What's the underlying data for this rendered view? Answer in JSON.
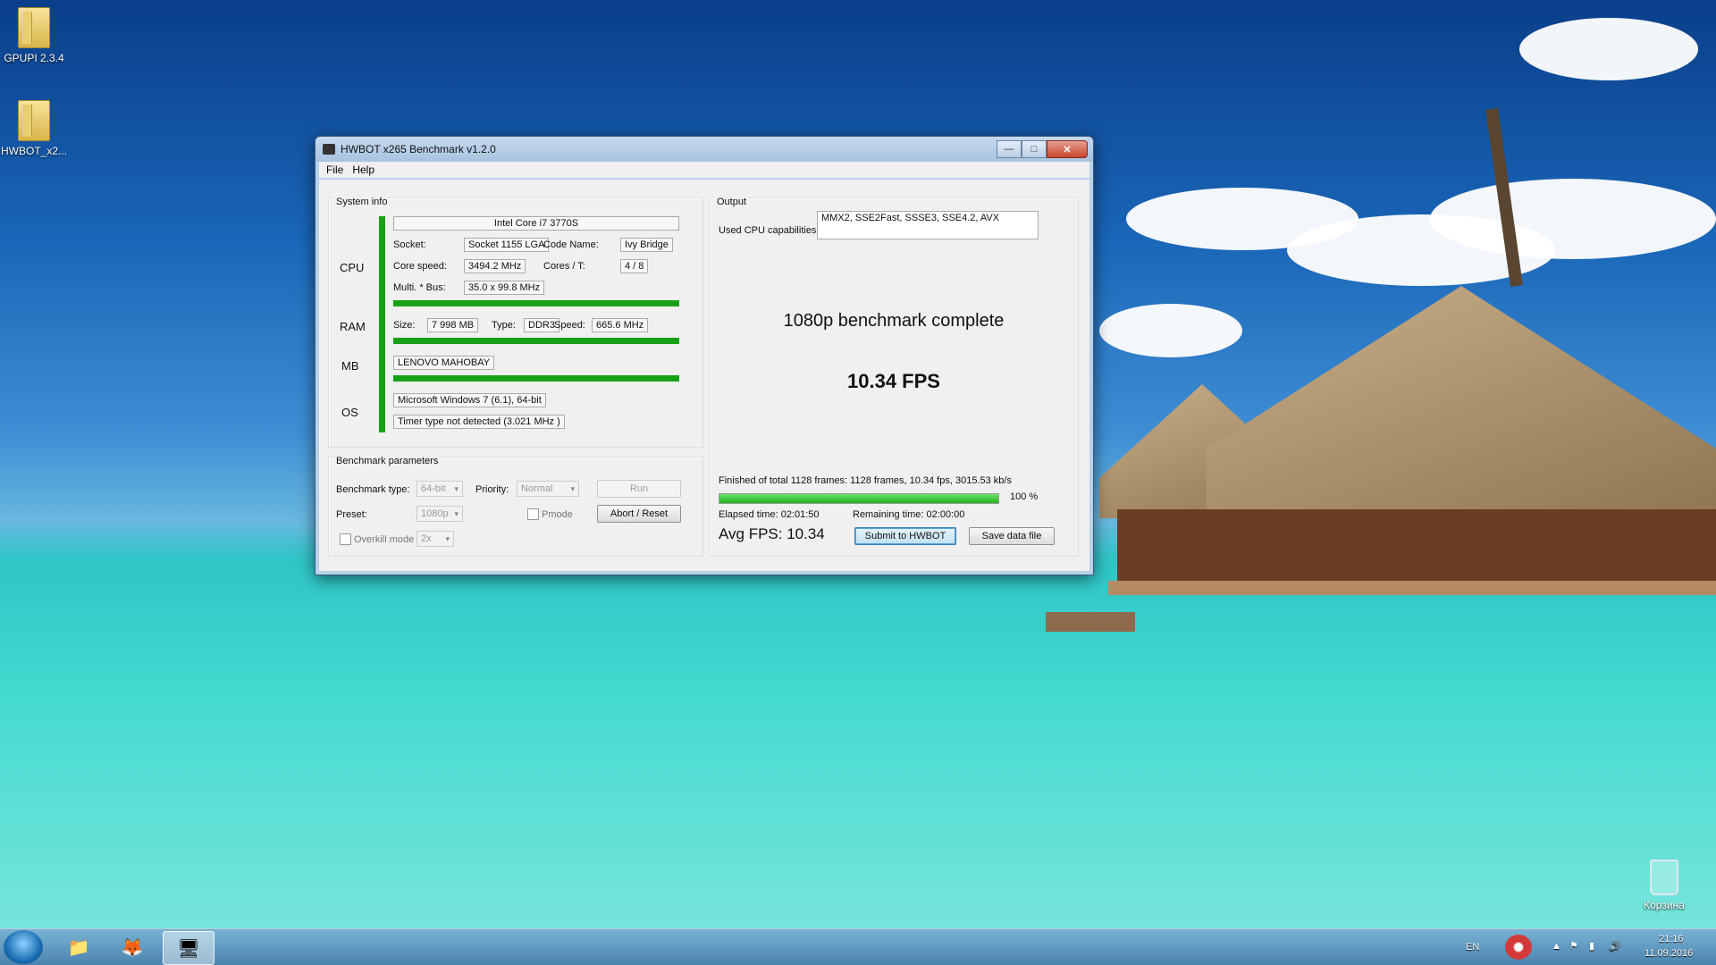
{
  "desktop": {
    "icons": [
      {
        "label": "GPUPI 2.3.4"
      },
      {
        "label": "HWBOT_x2..."
      }
    ],
    "recycle_bin_label": "Корзина"
  },
  "window": {
    "title": "HWBOT x265 Benchmark v1.2.0",
    "controls": {
      "minimize": "—",
      "maximize": "□",
      "close": "✕"
    },
    "menu": [
      "File",
      "Help"
    ]
  },
  "system_info": {
    "title": "System info",
    "side_labels": {
      "cpu": "CPU",
      "ram": "RAM",
      "mb": "MB",
      "os": "OS"
    },
    "cpu": {
      "name": "Intel Core i7 3770S",
      "socket_label": "Socket:",
      "socket": "Socket 1155 LGA",
      "codename_label": "Code Name:",
      "codename": "Ivy Bridge",
      "core_speed_label": "Core speed:",
      "core_speed": "3494.2 MHz",
      "cores_label": "Cores / T:",
      "cores": "4 / 8",
      "multi_label": "Multi. * Bus:",
      "multi": "35.0 x 99.8 MHz"
    },
    "ram": {
      "size_label": "Size:",
      "size": "7 998 MB",
      "type_label": "Type:",
      "type": "DDR3",
      "speed_label": "Speed:",
      "speed": "665.6 MHz"
    },
    "mb": {
      "name": "LENOVO MAHOBAY"
    },
    "os": {
      "name": "Microsoft Windows 7 (6.1), 64-bit",
      "timer": "Timer type not detected (3.021 MHz )"
    }
  },
  "benchmark_params": {
    "title": "Benchmark parameters",
    "type_label": "Benchmark type:",
    "type_value": "64-bit",
    "priority_label": "Priority:",
    "priority_value": "Normal",
    "run_label": "Run",
    "preset_label": "Preset:",
    "preset_value": "1080p",
    "pmode_label": "Pmode",
    "abort_label": "Abort / Reset",
    "overkill_label": "Overkill mode",
    "overkill_value": "2x"
  },
  "output": {
    "title": "Output",
    "cpu_caps_label": "Used CPU capabilities:",
    "cpu_caps": "MMX2, SSE2Fast, SSSE3, SSE4.2, AVX",
    "status": "1080p benchmark complete",
    "fps": "10.34 FPS",
    "summary": "Finished of total 1128 frames: 1128 frames, 10.34 fps,  3015.53 kb/s",
    "progress_percent": 100,
    "progress_label": "100 %",
    "elapsed": "Elapsed time: 02:01:50",
    "remaining": "Remaining time: 02:00:00",
    "avg_fps": "Avg FPS: 10.34",
    "submit_label": "Submit to HWBOT",
    "save_label": "Save data file"
  },
  "taskbar": {
    "language": "EN",
    "time": "21:16",
    "date": "11.09.2016"
  }
}
